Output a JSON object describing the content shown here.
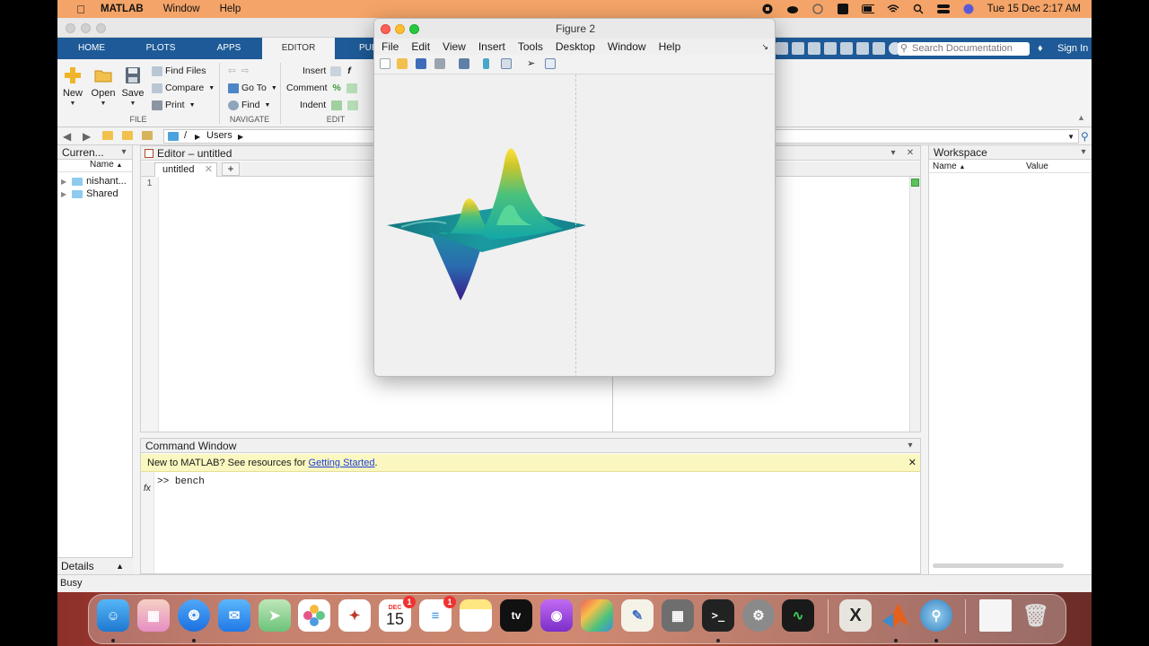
{
  "menubar": {
    "app_name": "MATLAB",
    "items": [
      "Window",
      "Help"
    ],
    "clock": "Tue 15 Dec  2:17 AM"
  },
  "toolstrip": {
    "tabs": [
      "HOME",
      "PLOTS",
      "APPS",
      "EDITOR",
      "PUB"
    ],
    "active_tab": "EDITOR",
    "file": {
      "new": "New",
      "open": "Open",
      "save": "Save",
      "find_files": "Find Files",
      "compare": "Compare",
      "print": "Print",
      "group": "FILE"
    },
    "navigate": {
      "go_to": "Go To",
      "find": "Find",
      "group": "NAVIGATE"
    },
    "edit": {
      "insert": "Insert",
      "comment": "Comment",
      "indent": "Indent",
      "group": "EDIT"
    },
    "search_placeholder": "Search Documentation",
    "sign_in": "Sign In"
  },
  "address": {
    "root": "/",
    "segment": "Users"
  },
  "current_folder": {
    "title": "Curren...",
    "column": "Name",
    "items": [
      "nishant...",
      "Shared"
    ]
  },
  "editor": {
    "title": "Editor – untitled",
    "tab": "untitled",
    "line_number": "1"
  },
  "command_window": {
    "title": "Command Window",
    "banner_text": "New to MATLAB? See resources for ",
    "banner_link": "Getting Started",
    "banner_end": ".",
    "prompt": ">>",
    "command": "bench",
    "fx": "fx"
  },
  "workspace": {
    "title": "Workspace",
    "col_name": "Name",
    "col_value": "Value"
  },
  "details_label": "Details",
  "status": "Busy",
  "figure": {
    "title": "Figure 2",
    "menu": [
      "File",
      "Edit",
      "View",
      "Insert",
      "Tools",
      "Desktop",
      "Window",
      "Help"
    ]
  },
  "dock": {
    "calendar_month": "DEC",
    "calendar_day": "15",
    "calendar_badge": "1",
    "reminders_badge": "1",
    "tv_label": "tv"
  },
  "colors": {
    "tab_bar": "#1d5a97",
    "menubar": "#f4a468",
    "banner": "#fbf7c1",
    "link": "#1b3fd6"
  }
}
